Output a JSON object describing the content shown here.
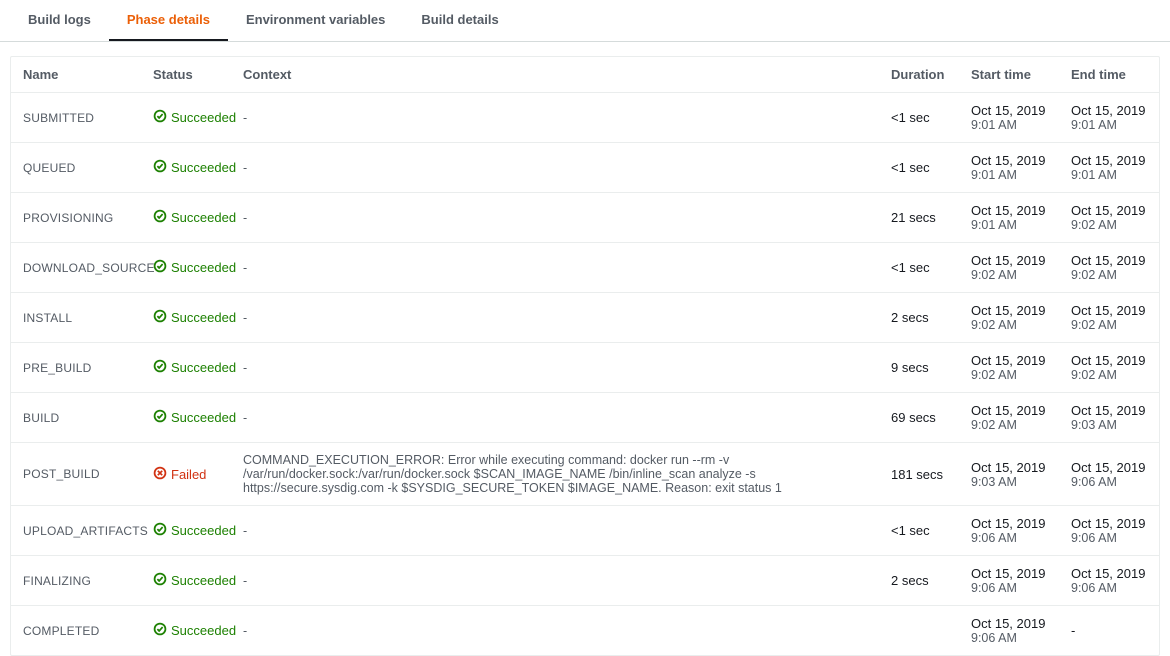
{
  "tabs": [
    {
      "label": "Build logs",
      "active": false
    },
    {
      "label": "Phase details",
      "active": true
    },
    {
      "label": "Environment variables",
      "active": false
    },
    {
      "label": "Build details",
      "active": false
    }
  ],
  "columns": {
    "name": "Name",
    "status": "Status",
    "context": "Context",
    "duration": "Duration",
    "start": "Start time",
    "end": "End time"
  },
  "statusLabels": {
    "success": "Succeeded",
    "failed": "Failed"
  },
  "phases": [
    {
      "name": "SUBMITTED",
      "status": "success",
      "context": "-",
      "duration": "<1 sec",
      "start1": "Oct 15, 2019",
      "start2": "9:01 AM",
      "end1": "Oct 15, 2019",
      "end2": "9:01 AM"
    },
    {
      "name": "QUEUED",
      "status": "success",
      "context": "-",
      "duration": "<1 sec",
      "start1": "Oct 15, 2019",
      "start2": "9:01 AM",
      "end1": "Oct 15, 2019",
      "end2": "9:01 AM"
    },
    {
      "name": "PROVISIONING",
      "status": "success",
      "context": "-",
      "duration": "21 secs",
      "start1": "Oct 15, 2019",
      "start2": "9:01 AM",
      "end1": "Oct 15, 2019",
      "end2": "9:02 AM"
    },
    {
      "name": "DOWNLOAD_SOURCE",
      "status": "success",
      "context": "-",
      "duration": "<1 sec",
      "start1": "Oct 15, 2019",
      "start2": "9:02 AM",
      "end1": "Oct 15, 2019",
      "end2": "9:02 AM"
    },
    {
      "name": "INSTALL",
      "status": "success",
      "context": "-",
      "duration": "2 secs",
      "start1": "Oct 15, 2019",
      "start2": "9:02 AM",
      "end1": "Oct 15, 2019",
      "end2": "9:02 AM"
    },
    {
      "name": "PRE_BUILD",
      "status": "success",
      "context": "-",
      "duration": "9 secs",
      "start1": "Oct 15, 2019",
      "start2": "9:02 AM",
      "end1": "Oct 15, 2019",
      "end2": "9:02 AM"
    },
    {
      "name": "BUILD",
      "status": "success",
      "context": "-",
      "duration": "69 secs",
      "start1": "Oct 15, 2019",
      "start2": "9:02 AM",
      "end1": "Oct 15, 2019",
      "end2": "9:03 AM"
    },
    {
      "name": "POST_BUILD",
      "status": "failed",
      "context": "COMMAND_EXECUTION_ERROR: Error while executing command: docker run --rm -v /var/run/docker.sock:/var/run/docker.sock $SCAN_IMAGE_NAME /bin/inline_scan analyze -s https://secure.sysdig.com -k $SYSDIG_SECURE_TOKEN $IMAGE_NAME. Reason: exit status 1",
      "duration": "181 secs",
      "start1": "Oct 15, 2019",
      "start2": "9:03 AM",
      "end1": "Oct 15, 2019",
      "end2": "9:06 AM"
    },
    {
      "name": "UPLOAD_ARTIFACTS",
      "status": "success",
      "context": "-",
      "duration": "<1 sec",
      "start1": "Oct 15, 2019",
      "start2": "9:06 AM",
      "end1": "Oct 15, 2019",
      "end2": "9:06 AM"
    },
    {
      "name": "FINALIZING",
      "status": "success",
      "context": "-",
      "duration": "2 secs",
      "start1": "Oct 15, 2019",
      "start2": "9:06 AM",
      "end1": "Oct 15, 2019",
      "end2": "9:06 AM"
    },
    {
      "name": "COMPLETED",
      "status": "success",
      "context": "-",
      "duration": "",
      "start1": "Oct 15, 2019",
      "start2": "9:06 AM",
      "end1": "-",
      "end2": ""
    }
  ]
}
